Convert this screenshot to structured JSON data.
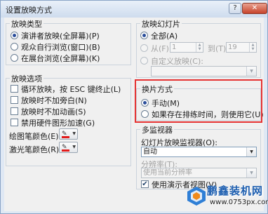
{
  "window": {
    "title": "设置放映方式",
    "help_glyph": "?",
    "close_glyph": "✕"
  },
  "show_type": {
    "title": "放映类型",
    "options": [
      {
        "label": "演讲者放映(全屏幕)(P)",
        "selected": true
      },
      {
        "label": "观众自行浏览(窗口)(B)",
        "selected": false
      },
      {
        "label": "在展台浏览(全屏幕)(K)",
        "selected": false
      }
    ]
  },
  "show_options": {
    "title": "放映选项",
    "checkboxes": [
      {
        "label": "循环放映，按 ESC 键终止(L)",
        "checked": false
      },
      {
        "label": "放映时不加旁白(N)",
        "checked": false
      },
      {
        "label": "放映时不加动画(S)",
        "checked": false
      },
      {
        "label": "禁用硬件图形加速(G)",
        "checked": false
      }
    ],
    "pen_color_label": "绘图笔颜色(E):",
    "laser_color_label": "激光笔颜色(R):",
    "pen_color": "#e31b1b",
    "laser_color": "#e31b1b"
  },
  "slides": {
    "title": "放映幻灯片",
    "all_label": "全部(A)",
    "from_label": "从(F):",
    "from_value": "1",
    "to_label": "到(T):",
    "to_value": "19",
    "custom_label": "自定义放映(C):",
    "custom_value": ""
  },
  "advance": {
    "title": "换片方式",
    "options": [
      {
        "label": "手动(M)",
        "selected": true
      },
      {
        "label": "如果存在排练时间，则使用它(U)",
        "selected": false
      }
    ],
    "highlight_color": "#e53232"
  },
  "multi_monitor": {
    "title": "多监视器",
    "monitor_label": "幻灯片放映监视器(O):",
    "monitor_value": "自动",
    "resolution_label": "分辨率(T):",
    "resolution_value": "使用当前分辨率",
    "presenter_view_label": "使用演示者视图(V)",
    "presenter_view_checked": true
  },
  "watermark": {
    "brand": "鹏鑫装机网",
    "url": "www.0753px.com"
  }
}
